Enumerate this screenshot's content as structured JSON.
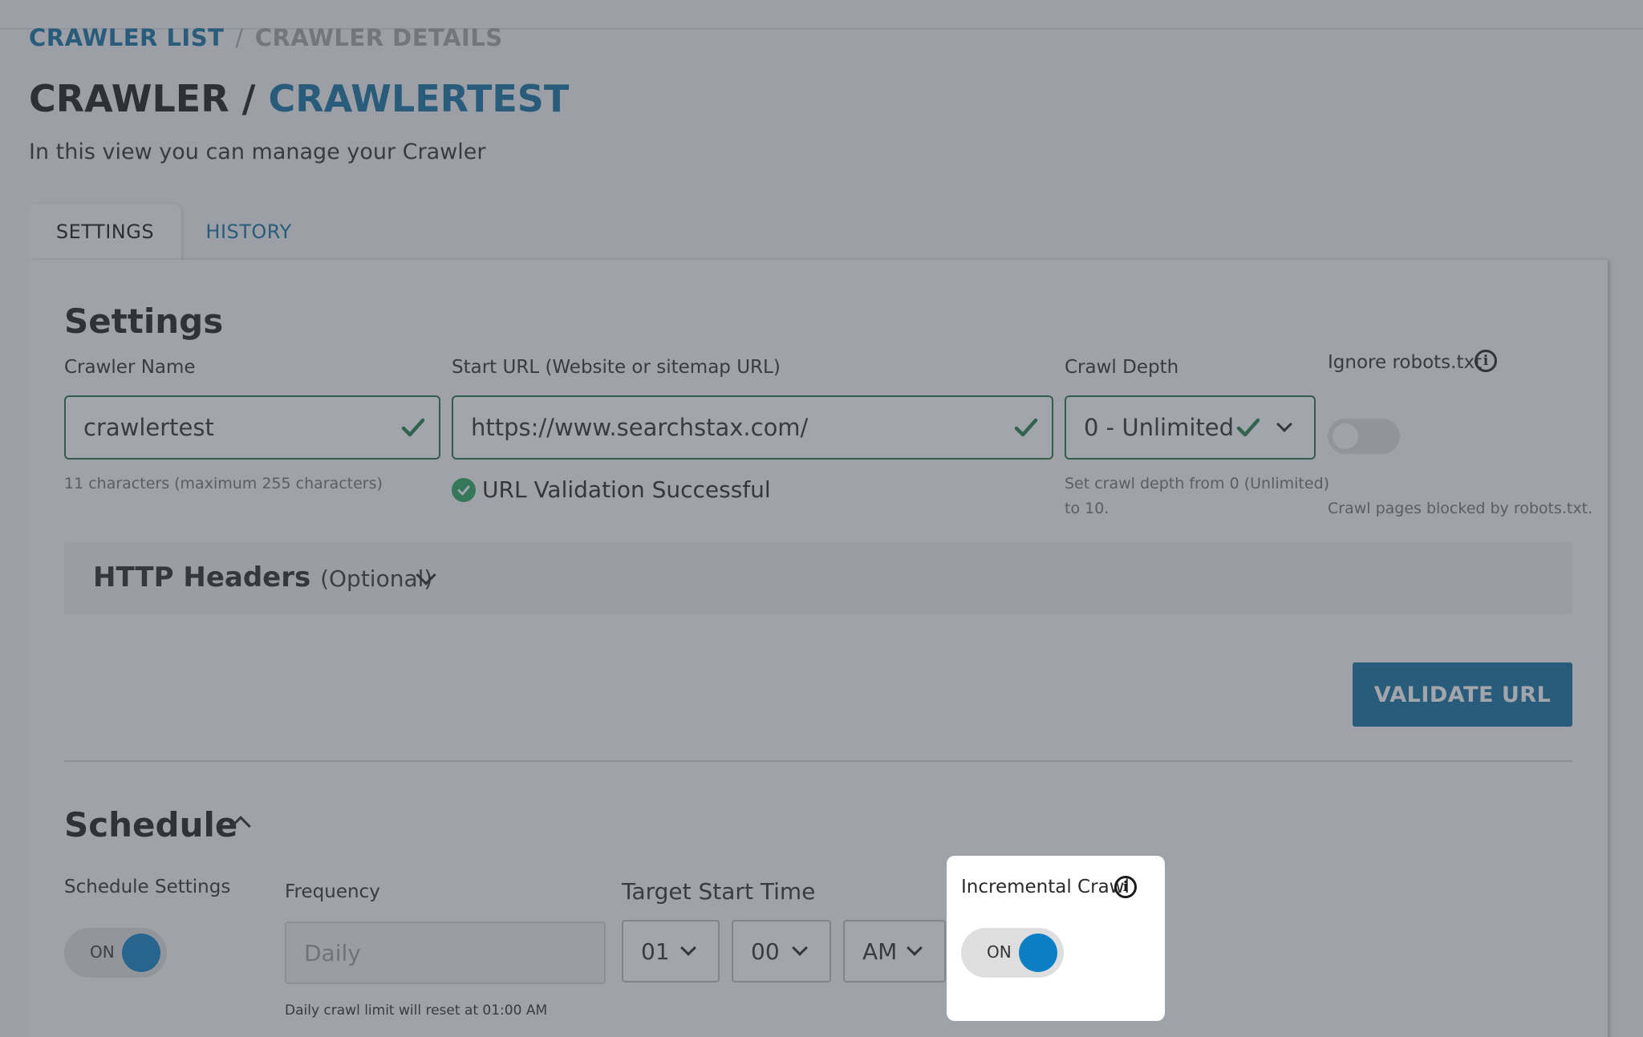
{
  "breadcrumb": {
    "parent": "CRAWLER LIST",
    "separator": "/",
    "current": "CRAWLER DETAILS"
  },
  "title": {
    "prefix": "CRAWLER /",
    "name": "CRAWLERTEST"
  },
  "subtitle": "In this view you can manage your Crawler",
  "tabs": [
    {
      "label": "SETTINGS",
      "active": true
    },
    {
      "label": "HISTORY",
      "active": false
    }
  ],
  "settings": {
    "heading": "Settings",
    "crawler_name": {
      "label": "Crawler Name",
      "value": "crawlertest",
      "hint": "11 characters (maximum 255 characters)"
    },
    "start_url": {
      "label": "Start URL (Website or sitemap URL)",
      "value": "https://www.searchstax.com/",
      "validation": "URL Validation Successful"
    },
    "crawl_depth": {
      "label": "Crawl Depth",
      "value": "0 - Unlimited",
      "hint_line1": "Set crawl depth from 0 (Unlimited)",
      "hint_line2": "to 10."
    },
    "ignore_robots": {
      "label": "Ignore robots.txt",
      "info_glyph": "i",
      "hint": "Crawl pages blocked by robots.txt.",
      "enabled": false
    },
    "http_headers": {
      "title": "HTTP Headers",
      "optional": "(Optional)"
    },
    "validate_button": "VALIDATE URL"
  },
  "schedule": {
    "heading": "Schedule",
    "schedule_settings": {
      "label": "Schedule Settings",
      "toggle": "ON"
    },
    "frequency": {
      "label": "Frequency",
      "value": "Daily",
      "hint": "Daily crawl limit will reset at 01:00 AM"
    },
    "target_start_time": {
      "label": "Target Start Time",
      "hour": "01",
      "minute": "00",
      "meridiem": "AM"
    },
    "incremental_crawl": {
      "label": "Incremental Crawl",
      "info_glyph": "i",
      "toggle": "ON"
    }
  },
  "colors": {
    "brand_blue": "#0a6d9c",
    "success_green": "#1e6e3f",
    "toggle_blue": "#0a7fc4",
    "overlay": "rgba(70,76,88,0.50)"
  },
  "icons": [
    "check-icon",
    "chevron-down-icon",
    "chevron-up-icon",
    "info-icon",
    "success-check-icon"
  ]
}
